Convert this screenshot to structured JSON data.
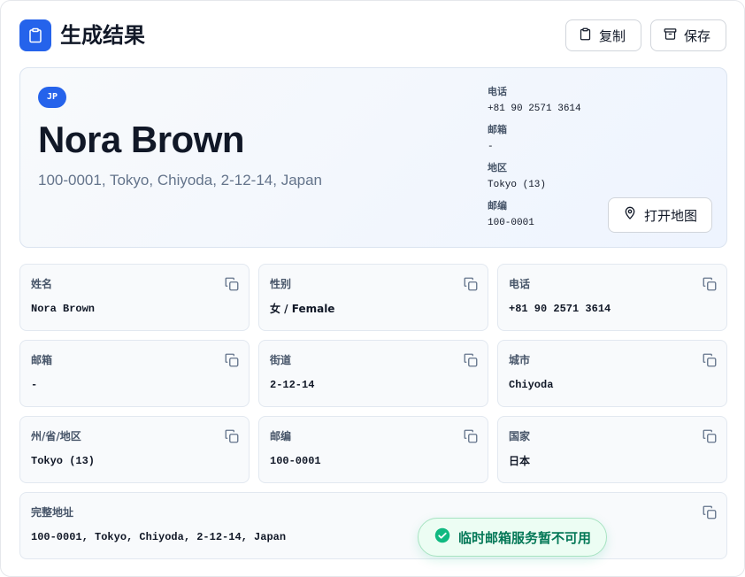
{
  "header": {
    "title": "生成结果",
    "copy_label": "复制",
    "save_label": "保存"
  },
  "hero": {
    "country_code": "JP",
    "name": "Nora Brown",
    "address": "100-0001, Tokyo, Chiyoda, 2-12-14, Japan",
    "info": [
      {
        "label": "电话",
        "value": "+81 90 2571 3614"
      },
      {
        "label": "邮箱",
        "value": "-"
      },
      {
        "label": "地区",
        "value": "Tokyo (13)"
      },
      {
        "label": "邮编",
        "value": "100-0001"
      }
    ],
    "map_button_label": "打开地图"
  },
  "fields": [
    {
      "label": "姓名",
      "value": "Nora Brown"
    },
    {
      "label": "性别",
      "value": "女 / Female"
    },
    {
      "label": "电话",
      "value": "+81 90 2571 3614"
    },
    {
      "label": "邮箱",
      "value": "-"
    },
    {
      "label": "街道",
      "value": "2-12-14"
    },
    {
      "label": "城市",
      "value": "Chiyoda"
    },
    {
      "label": "州/省/地区",
      "value": "Tokyo (13)"
    },
    {
      "label": "邮编",
      "value": "100-0001"
    },
    {
      "label": "国家",
      "value": "日本"
    }
  ],
  "full_address": {
    "label": "完整地址",
    "value": "100-0001, Tokyo, Chiyoda, 2-12-14, Japan"
  },
  "toast": {
    "message": "临时邮箱服务暂不可用"
  },
  "colors": {
    "accent": "#2563eb",
    "success": "#10b981",
    "success_text": "#047857"
  }
}
